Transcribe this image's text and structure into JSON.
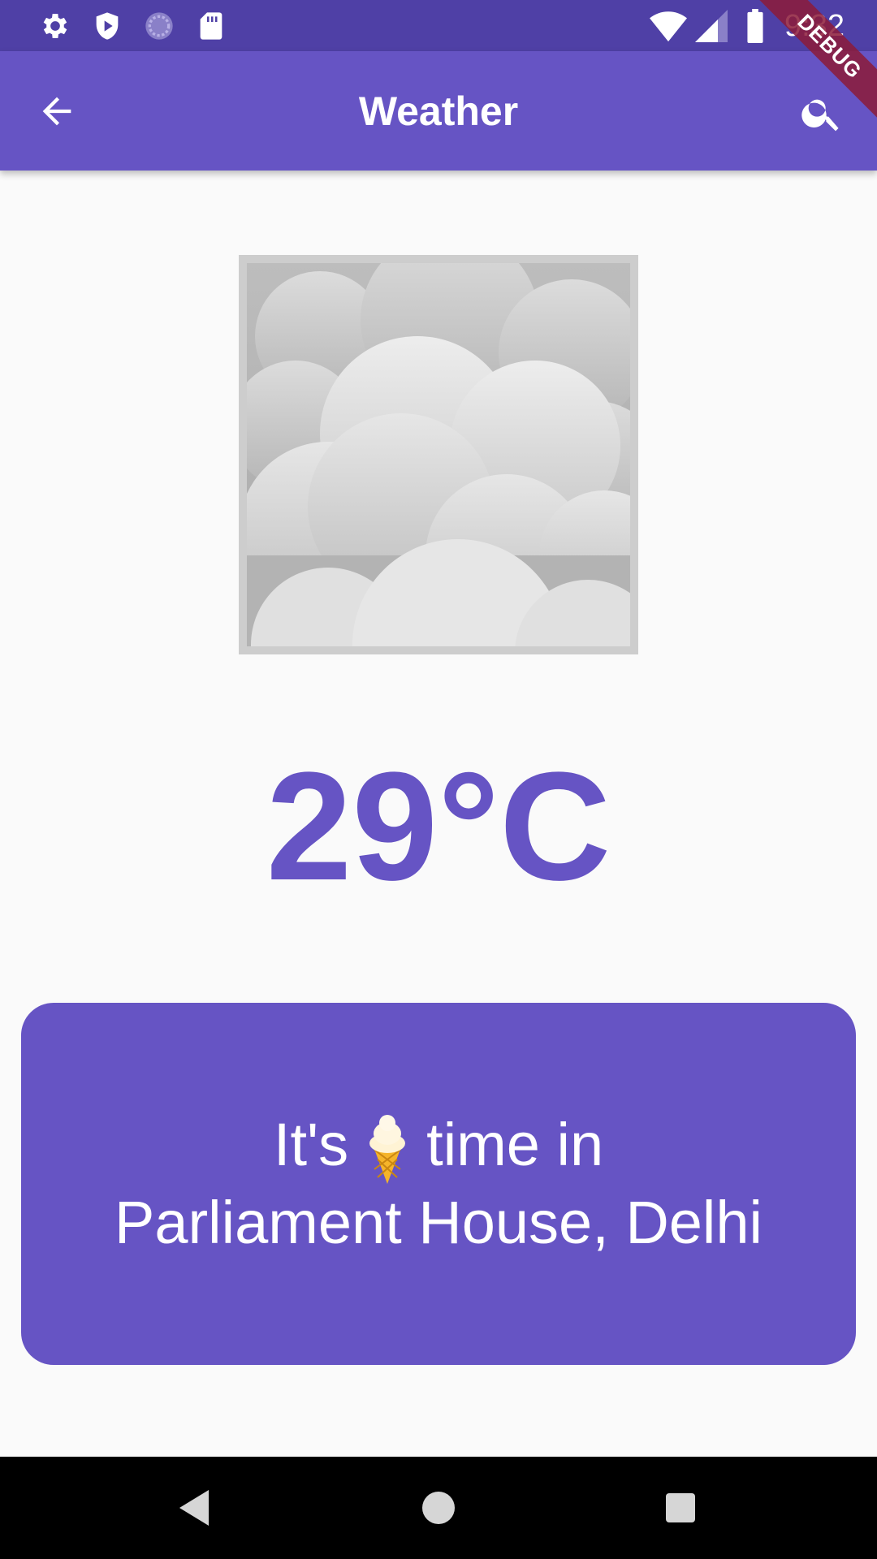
{
  "status_bar": {
    "time": "9:32",
    "left_icons": [
      "settings-icon",
      "shield-play-icon",
      "sync-icon",
      "sd-card-icon"
    ],
    "right_icons": [
      "wifi-icon",
      "signal-icon",
      "battery-icon"
    ]
  },
  "debug_banner": "DEBUG",
  "app_bar": {
    "title": "Weather",
    "back_icon": "arrow-back-icon",
    "search_icon": "search-icon"
  },
  "weather": {
    "condition_icon": "cloudy-image",
    "temperature": "29°C"
  },
  "message": {
    "line1_prefix": "It's",
    "emoji": "ice-cream-emoji",
    "line1_suffix": "time in",
    "line2": "Parliament House, Delhi"
  },
  "colors": {
    "primary": "#6654C4",
    "status_bar": "#4F40A6",
    "background": "#FAFAFA",
    "nav_bar": "#000000"
  },
  "nav_bar": {
    "buttons": [
      "back-triangle-icon",
      "home-circle-icon",
      "recents-square-icon"
    ]
  }
}
